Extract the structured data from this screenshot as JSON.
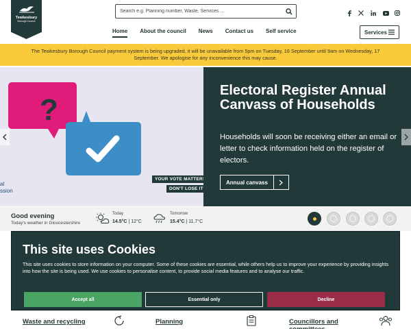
{
  "header": {
    "logo": {
      "name": "Tewkesbury",
      "sub": "Borough Council"
    },
    "search": {
      "placeholder": "Search e.g. Planning number, Waste, Services ..."
    },
    "social": [
      "facebook-icon",
      "x-icon",
      "linkedin-icon",
      "youtube-icon",
      "instagram-icon"
    ],
    "nav": [
      {
        "label": "Home",
        "active": true
      },
      {
        "label": "About the council",
        "active": false
      },
      {
        "label": "News",
        "active": false
      },
      {
        "label": "Contact us",
        "active": false
      },
      {
        "label": "Self service",
        "active": false
      }
    ],
    "services_label": "Services"
  },
  "alert": {
    "text": "The Tewkesbury Borough Council payment system is being upgraded, it will be unavailable from 5pm on Tuesday, 16 September until 9am on Wednesday, 17 September. We apologise for any inconvenience this may cause."
  },
  "hero": {
    "title": "Electoral Register Annual Canvass of Households",
    "text": "Households will soon be receiving either an email or letter to check information held on the register of electors.",
    "cta": "Annual canvass",
    "image_tag1": "YOUR VOTE MATTERS",
    "image_tag2": "DON'T LOSE IT",
    "image_edge1": "al",
    "image_edge2": "ssion"
  },
  "weather": {
    "greeting": "Good evening",
    "location": "Today's weather in Gloucestershire",
    "today": {
      "label": "Today",
      "high": "14.5°C",
      "low": "12°C"
    },
    "tomorrow": {
      "label": "Tomorrow",
      "high": "15.4°C",
      "low": "11.7°C"
    }
  },
  "slider": {
    "count": 5,
    "active": 1
  },
  "cards": [
    {
      "title": "Waste and recycling",
      "icon": "recycling-icon"
    },
    {
      "title": "Planning",
      "icon": "clipboard-icon"
    },
    {
      "title": "Councillors and committees",
      "icon": "people-icon"
    }
  ],
  "cookie": {
    "title": "This site uses Cookies",
    "text": "This site uses cookies to store information on your computer. Some of these cookies are essential, while others help us to improve your experience by providing insights into how the site is being used. We use cookies to personalise content, to provide social media features and to analyse our traffic.",
    "accept": "Accept all",
    "essential": "Essential only",
    "decline": "Decline"
  },
  "colors": {
    "brand": "#22393a",
    "alert": "#f8ca3c",
    "accept": "#4aa564",
    "decline": "#9b2c47"
  }
}
